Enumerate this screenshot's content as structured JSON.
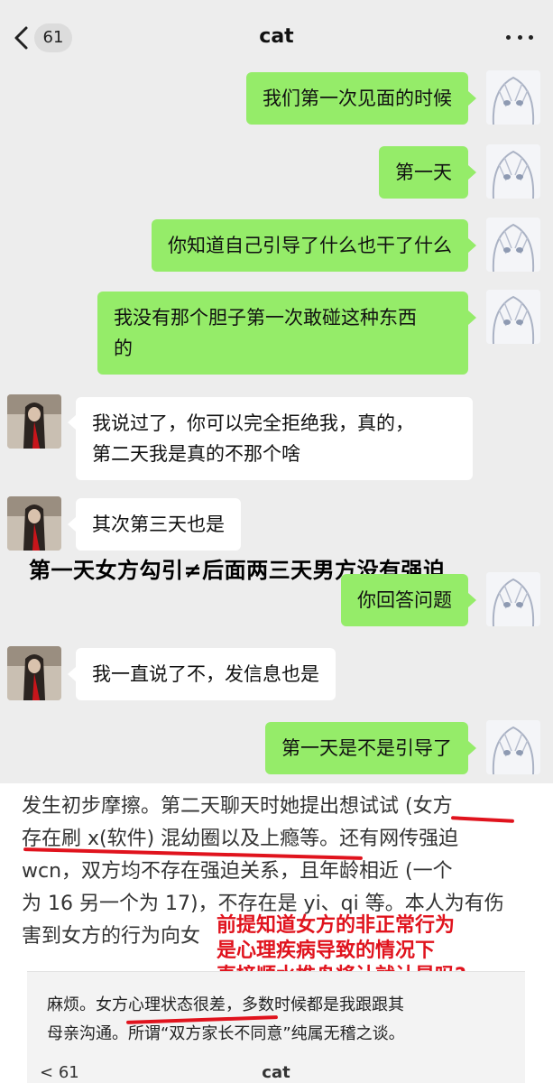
{
  "header": {
    "title": "cat",
    "unread_count": "61"
  },
  "messages": [
    {
      "side": "right",
      "text": "我们第一次见面的时候"
    },
    {
      "side": "right",
      "text": "第一天"
    },
    {
      "side": "right",
      "text": "你知道自己引导了什么也干了什么"
    },
    {
      "side": "right",
      "lines": [
        "我没有那个胆子第一次敢碰这种东西",
        "的"
      ]
    },
    {
      "side": "left",
      "lines": [
        "我说过了，你可以完全拒绝我，真的，",
        "第二天我是真的不那个啥"
      ]
    },
    {
      "side": "left",
      "text": "其次第三天也是"
    },
    {
      "side": "right",
      "text": "你回答问题"
    },
    {
      "side": "left",
      "text": "我一直说了不，发信息也是"
    },
    {
      "side": "right",
      "text": "第一天是不是引导了"
    }
  ],
  "overlay_caption": "第一天女方勾引≠后面两三天男方没有强迫",
  "article": {
    "lines": [
      "发生初步摩擦。第二天聊天时她提出想试试 (女方",
      "存在刷 x(软件) 混幼圈以及上瘾等。还有网传强迫",
      "wcn，双方均不存在强迫关系，且年龄相近 (一个",
      "为 16 另一个为 17)，不存在是 yi、qi 等。本人为有伤",
      "害到女方的行为向女"
    ],
    "annotation_lines": [
      "前提知道女方的非正常行为",
      "是心理疾病导致的情况下",
      "直接顺水推舟将计就计是吗?"
    ]
  },
  "inset": {
    "lines": [
      "麻烦。女方心理状态很差，多数时候都是我跟跟其",
      "母亲沟通。所谓“双方家长不同意”纯属无稽之谈。"
    ],
    "footer_count": "61",
    "footer_title": "cat"
  },
  "colors": {
    "chat_background": "#ededed",
    "sent_bubble": "#95ec69",
    "received_bubble": "#ffffff",
    "annotation_red": "#e0131d"
  }
}
